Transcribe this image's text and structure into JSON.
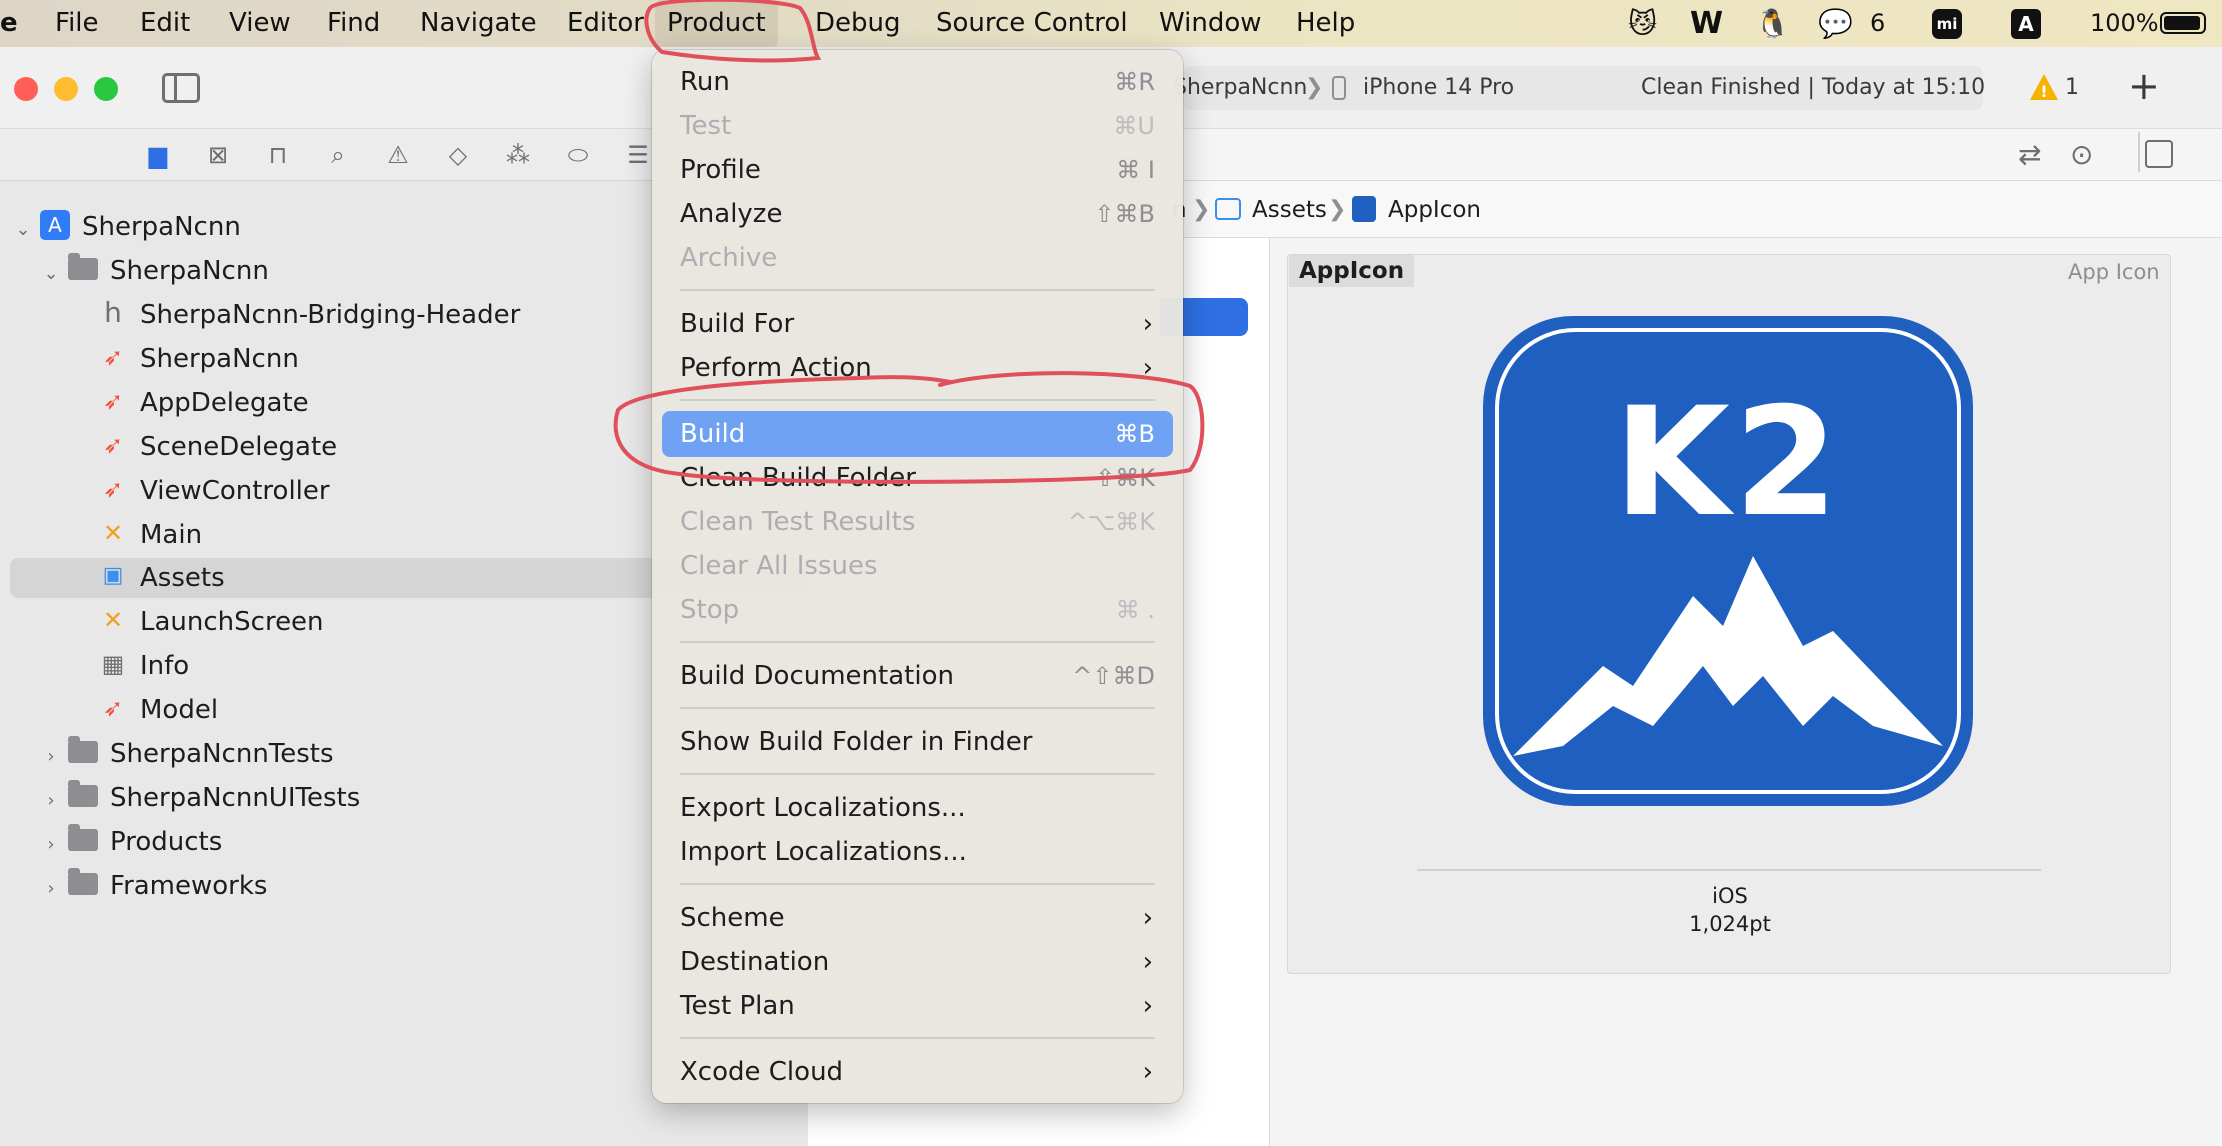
{
  "menubar": {
    "app_fragment": "e",
    "menus": [
      "File",
      "Edit",
      "View",
      "Find",
      "Navigate",
      "Editor",
      "Product",
      "Debug",
      "Source Control",
      "Window",
      "Help"
    ],
    "wechat_count": "6",
    "input_source": "A",
    "battery": "100%"
  },
  "toolbar": {
    "scheme_fragment": "SherpaNcnn",
    "device": "iPhone 14 Pro",
    "status": "Clean Finished | Today at 15:10",
    "warnings": "1",
    "add": "+"
  },
  "sidebar": {
    "items": [
      {
        "label": "SherpaNcnn",
        "icon": "project-icon",
        "level": 0
      },
      {
        "label": "SherpaNcnn",
        "icon": "folder-icon",
        "level": 1
      },
      {
        "label": "SherpaNcnn-Bridging-Header",
        "icon": "header-file-icon",
        "level": 2
      },
      {
        "label": "SherpaNcnn",
        "icon": "swift-file-icon",
        "level": 2
      },
      {
        "label": "AppDelegate",
        "icon": "swift-file-icon",
        "level": 2
      },
      {
        "label": "SceneDelegate",
        "icon": "swift-file-icon",
        "level": 2
      },
      {
        "label": "ViewController",
        "icon": "swift-file-icon",
        "level": 2
      },
      {
        "label": "Main",
        "icon": "storyboard-icon",
        "level": 2
      },
      {
        "label": "Assets",
        "icon": "asset-catalog-icon",
        "level": 2,
        "selected": true
      },
      {
        "label": "LaunchScreen",
        "icon": "storyboard-icon",
        "level": 2
      },
      {
        "label": "Info",
        "icon": "plist-icon",
        "level": 2
      },
      {
        "label": "Model",
        "icon": "swift-file-icon",
        "level": 2
      },
      {
        "label": "SherpaNcnnTests",
        "icon": "folder-icon",
        "level": 1
      },
      {
        "label": "SherpaNcnnUITests",
        "icon": "folder-icon",
        "level": 1
      },
      {
        "label": "Products",
        "icon": "folder-icon",
        "level": 1
      },
      {
        "label": "Frameworks",
        "icon": "folder-icon",
        "level": 1
      }
    ]
  },
  "breadcrumb": {
    "fragment": "n",
    "assets": "Assets",
    "appicon": "AppIcon"
  },
  "asset": {
    "name": "AppIcon",
    "type": "App Icon",
    "icon_text": "K2",
    "platform": "iOS",
    "size": "1,024pt"
  },
  "menu": {
    "items": [
      {
        "label": "Run",
        "shortcut": "⌘R"
      },
      {
        "label": "Test",
        "shortcut": "⌘U",
        "disabled": true
      },
      {
        "label": "Profile",
        "shortcut": "⌘ I"
      },
      {
        "label": "Analyze",
        "shortcut": "⇧⌘B"
      },
      {
        "label": "Archive",
        "shortcut": "",
        "disabled": true
      },
      {
        "label": "Build For",
        "submenu": true
      },
      {
        "label": "Perform Action",
        "submenu": true
      },
      {
        "label": "Build",
        "shortcut": "⌘B",
        "highlighted": true
      },
      {
        "label": "Clean Build Folder",
        "shortcut": "⇧⌘K"
      },
      {
        "label": "Clean Test Results",
        "shortcut": "^⌥⌘K",
        "disabled": true
      },
      {
        "label": "Clear All Issues",
        "shortcut": "",
        "disabled": true
      },
      {
        "label": "Stop",
        "shortcut": "⌘ .",
        "disabled": true
      },
      {
        "label": "Build Documentation",
        "shortcut": "^⇧⌘D"
      },
      {
        "label": "Show Build Folder in Finder",
        "shortcut": ""
      },
      {
        "label": "Export Localizations...",
        "shortcut": ""
      },
      {
        "label": "Import Localizations...",
        "shortcut": ""
      },
      {
        "label": "Scheme",
        "submenu": true
      },
      {
        "label": "Destination",
        "submenu": true
      },
      {
        "label": "Test Plan",
        "submenu": true
      },
      {
        "label": "Xcode Cloud",
        "submenu": true
      }
    ]
  },
  "colors": {
    "accent": "#2f6fe4",
    "menu_highlight": "#6fa2f2",
    "annotation": "#e0505a",
    "app_icon_bg": "#1f5fbf"
  }
}
